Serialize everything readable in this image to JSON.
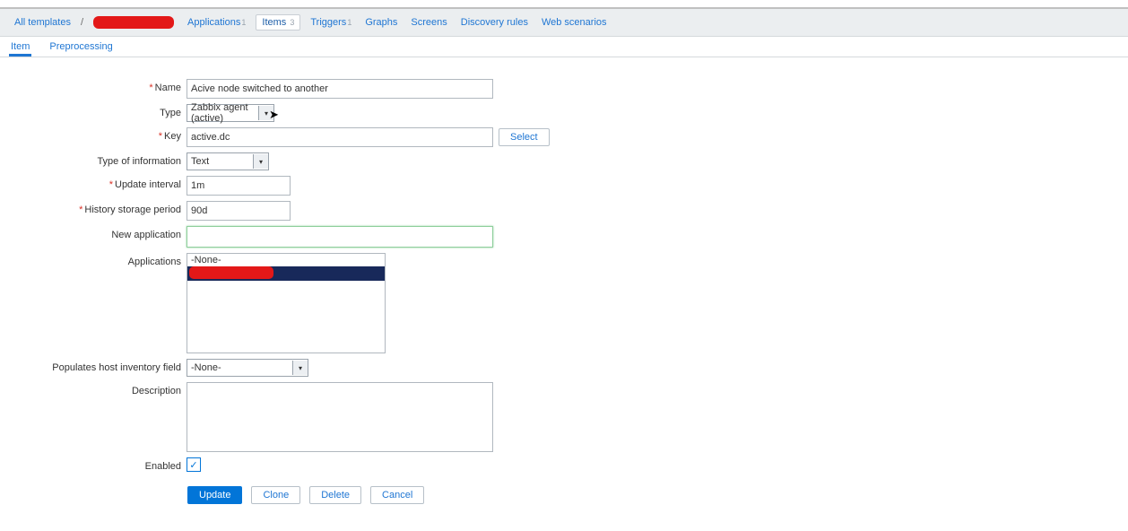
{
  "breadcrumb": {
    "all_templates": "All templates",
    "applications": "Applications",
    "applications_count": "1",
    "items": "Items",
    "items_count": "3",
    "triggers": "Triggers",
    "triggers_count": "1",
    "graphs": "Graphs",
    "screens": "Screens",
    "discovery_rules": "Discovery rules",
    "web_scenarios": "Web scenarios"
  },
  "tabs": {
    "item": "Item",
    "preprocessing": "Preprocessing"
  },
  "labels": {
    "name": "Name",
    "type": "Type",
    "key": "Key",
    "type_of_information": "Type of information",
    "update_interval": "Update interval",
    "history_storage_period": "History storage period",
    "new_application": "New application",
    "applications": "Applications",
    "populates_host_inventory_field": "Populates host inventory field",
    "description": "Description",
    "enabled": "Enabled"
  },
  "values": {
    "name": "Acive node switched to another",
    "type": "Zabbix agent (active)",
    "key": "active.dc",
    "type_of_information": "Text",
    "update_interval": "1m",
    "history_storage_period": "90d",
    "new_application": "",
    "applications_none": "-None-",
    "inventory_none": "-None-",
    "description": ""
  },
  "buttons": {
    "select": "Select",
    "update": "Update",
    "clone": "Clone",
    "delete": "Delete",
    "cancel": "Cancel"
  }
}
